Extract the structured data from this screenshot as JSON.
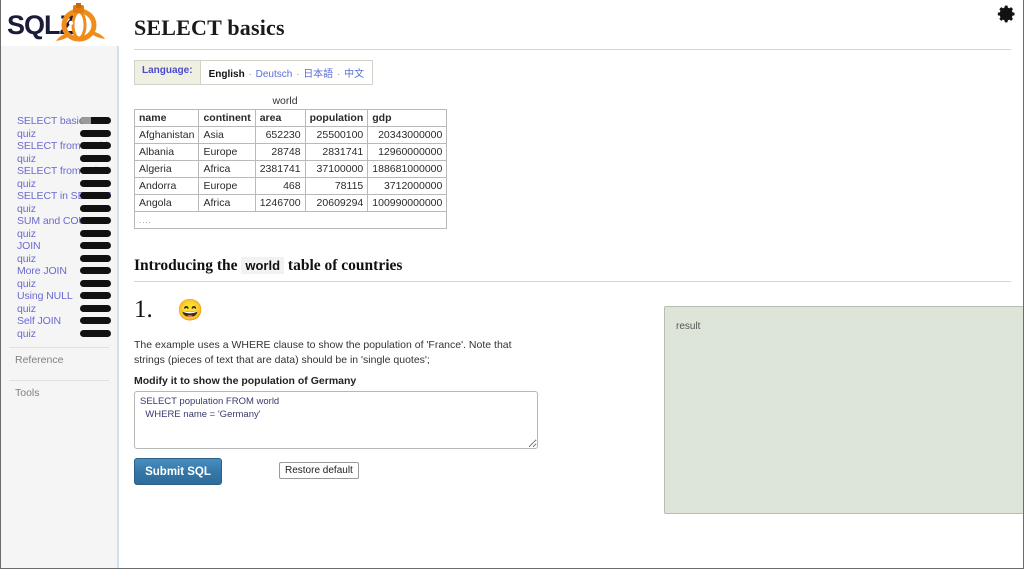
{
  "window": {
    "gear_icon": "gear-icon"
  },
  "sidebar": {
    "logo_text": "SQLZOO",
    "items": [
      {
        "label": "SELECT basics",
        "type": "topic",
        "progress": 35
      },
      {
        "label": "quiz",
        "type": "quiz",
        "progress": 0
      },
      {
        "label": "SELECT from world",
        "type": "topic",
        "progress": 0
      },
      {
        "label": "quiz",
        "type": "quiz",
        "progress": 0
      },
      {
        "label": "SELECT from nobel",
        "type": "topic",
        "progress": 0
      },
      {
        "label": "quiz",
        "type": "quiz",
        "progress": 0
      },
      {
        "label": "SELECT in SELECT",
        "type": "topic",
        "progress": 0
      },
      {
        "label": "quiz",
        "type": "quiz",
        "progress": 0
      },
      {
        "label": "SUM and COUNT",
        "type": "topic",
        "progress": 0
      },
      {
        "label": "quiz",
        "type": "quiz",
        "progress": 0
      },
      {
        "label": "JOIN",
        "type": "topic",
        "progress": 0
      },
      {
        "label": "quiz",
        "type": "quiz",
        "progress": 0
      },
      {
        "label": "More JOIN",
        "type": "topic",
        "progress": 0
      },
      {
        "label": "quiz",
        "type": "quiz",
        "progress": 0
      },
      {
        "label": "Using NULL",
        "type": "topic",
        "progress": 0
      },
      {
        "label": "quiz",
        "type": "quiz",
        "progress": 0
      },
      {
        "label": "Self JOIN",
        "type": "topic",
        "progress": 0
      },
      {
        "label": "quiz",
        "type": "quiz",
        "progress": 0
      }
    ],
    "footer_items": [
      {
        "label": "Reference"
      },
      {
        "label": "Tools"
      }
    ]
  },
  "header": {
    "title": "SELECT basics"
  },
  "language_bar": {
    "label": "Language:",
    "active": "English",
    "options": [
      "Deutsch",
      "日本語",
      "中文"
    ],
    "separator": "·"
  },
  "world_table": {
    "caption": "world",
    "columns": [
      "name",
      "continent",
      "area",
      "population",
      "gdp"
    ],
    "column_align": [
      "left",
      "left",
      "right",
      "right",
      "right"
    ],
    "rows": [
      [
        "Afghanistan",
        "Asia",
        "652230",
        "25500100",
        "20343000000"
      ],
      [
        "Albania",
        "Europe",
        "28748",
        "2831741",
        "12960000000"
      ],
      [
        "Algeria",
        "Africa",
        "2381741",
        "37100000",
        "188681000000"
      ],
      [
        "Andorra",
        "Europe",
        "468",
        "78115",
        "3712000000"
      ],
      [
        "Angola",
        "Africa",
        "1246700",
        "20609294",
        "100990000000"
      ]
    ],
    "ellipsis_row": "...."
  },
  "section": {
    "title_prefix": "Introducing the",
    "title_code": "world",
    "title_suffix": "table of countries"
  },
  "question": {
    "number": "1.",
    "emoji": "😄",
    "emoji_name": "smiling-face-emoji",
    "body": "The example uses a WHERE clause to show the population of 'France'. Note that strings (pieces of text that are data) should be in 'single quotes';",
    "task": "Modify it to show the population of Germany",
    "sql_value": "SELECT population FROM world\n  WHERE name = 'Germany'",
    "submit_label": "Submit SQL",
    "restore_label": "Restore default"
  },
  "result": {
    "placeholder": "result"
  },
  "colors": {
    "sidebar_bg": "#f5f5f5",
    "sidebar_border": "#cfe0ee",
    "link": "#6a6ad0",
    "submit_button": "#3478a8",
    "result_bg": "#dde5d8",
    "progress_track": "#111111",
    "progress_fill": "#9a9a9a"
  }
}
